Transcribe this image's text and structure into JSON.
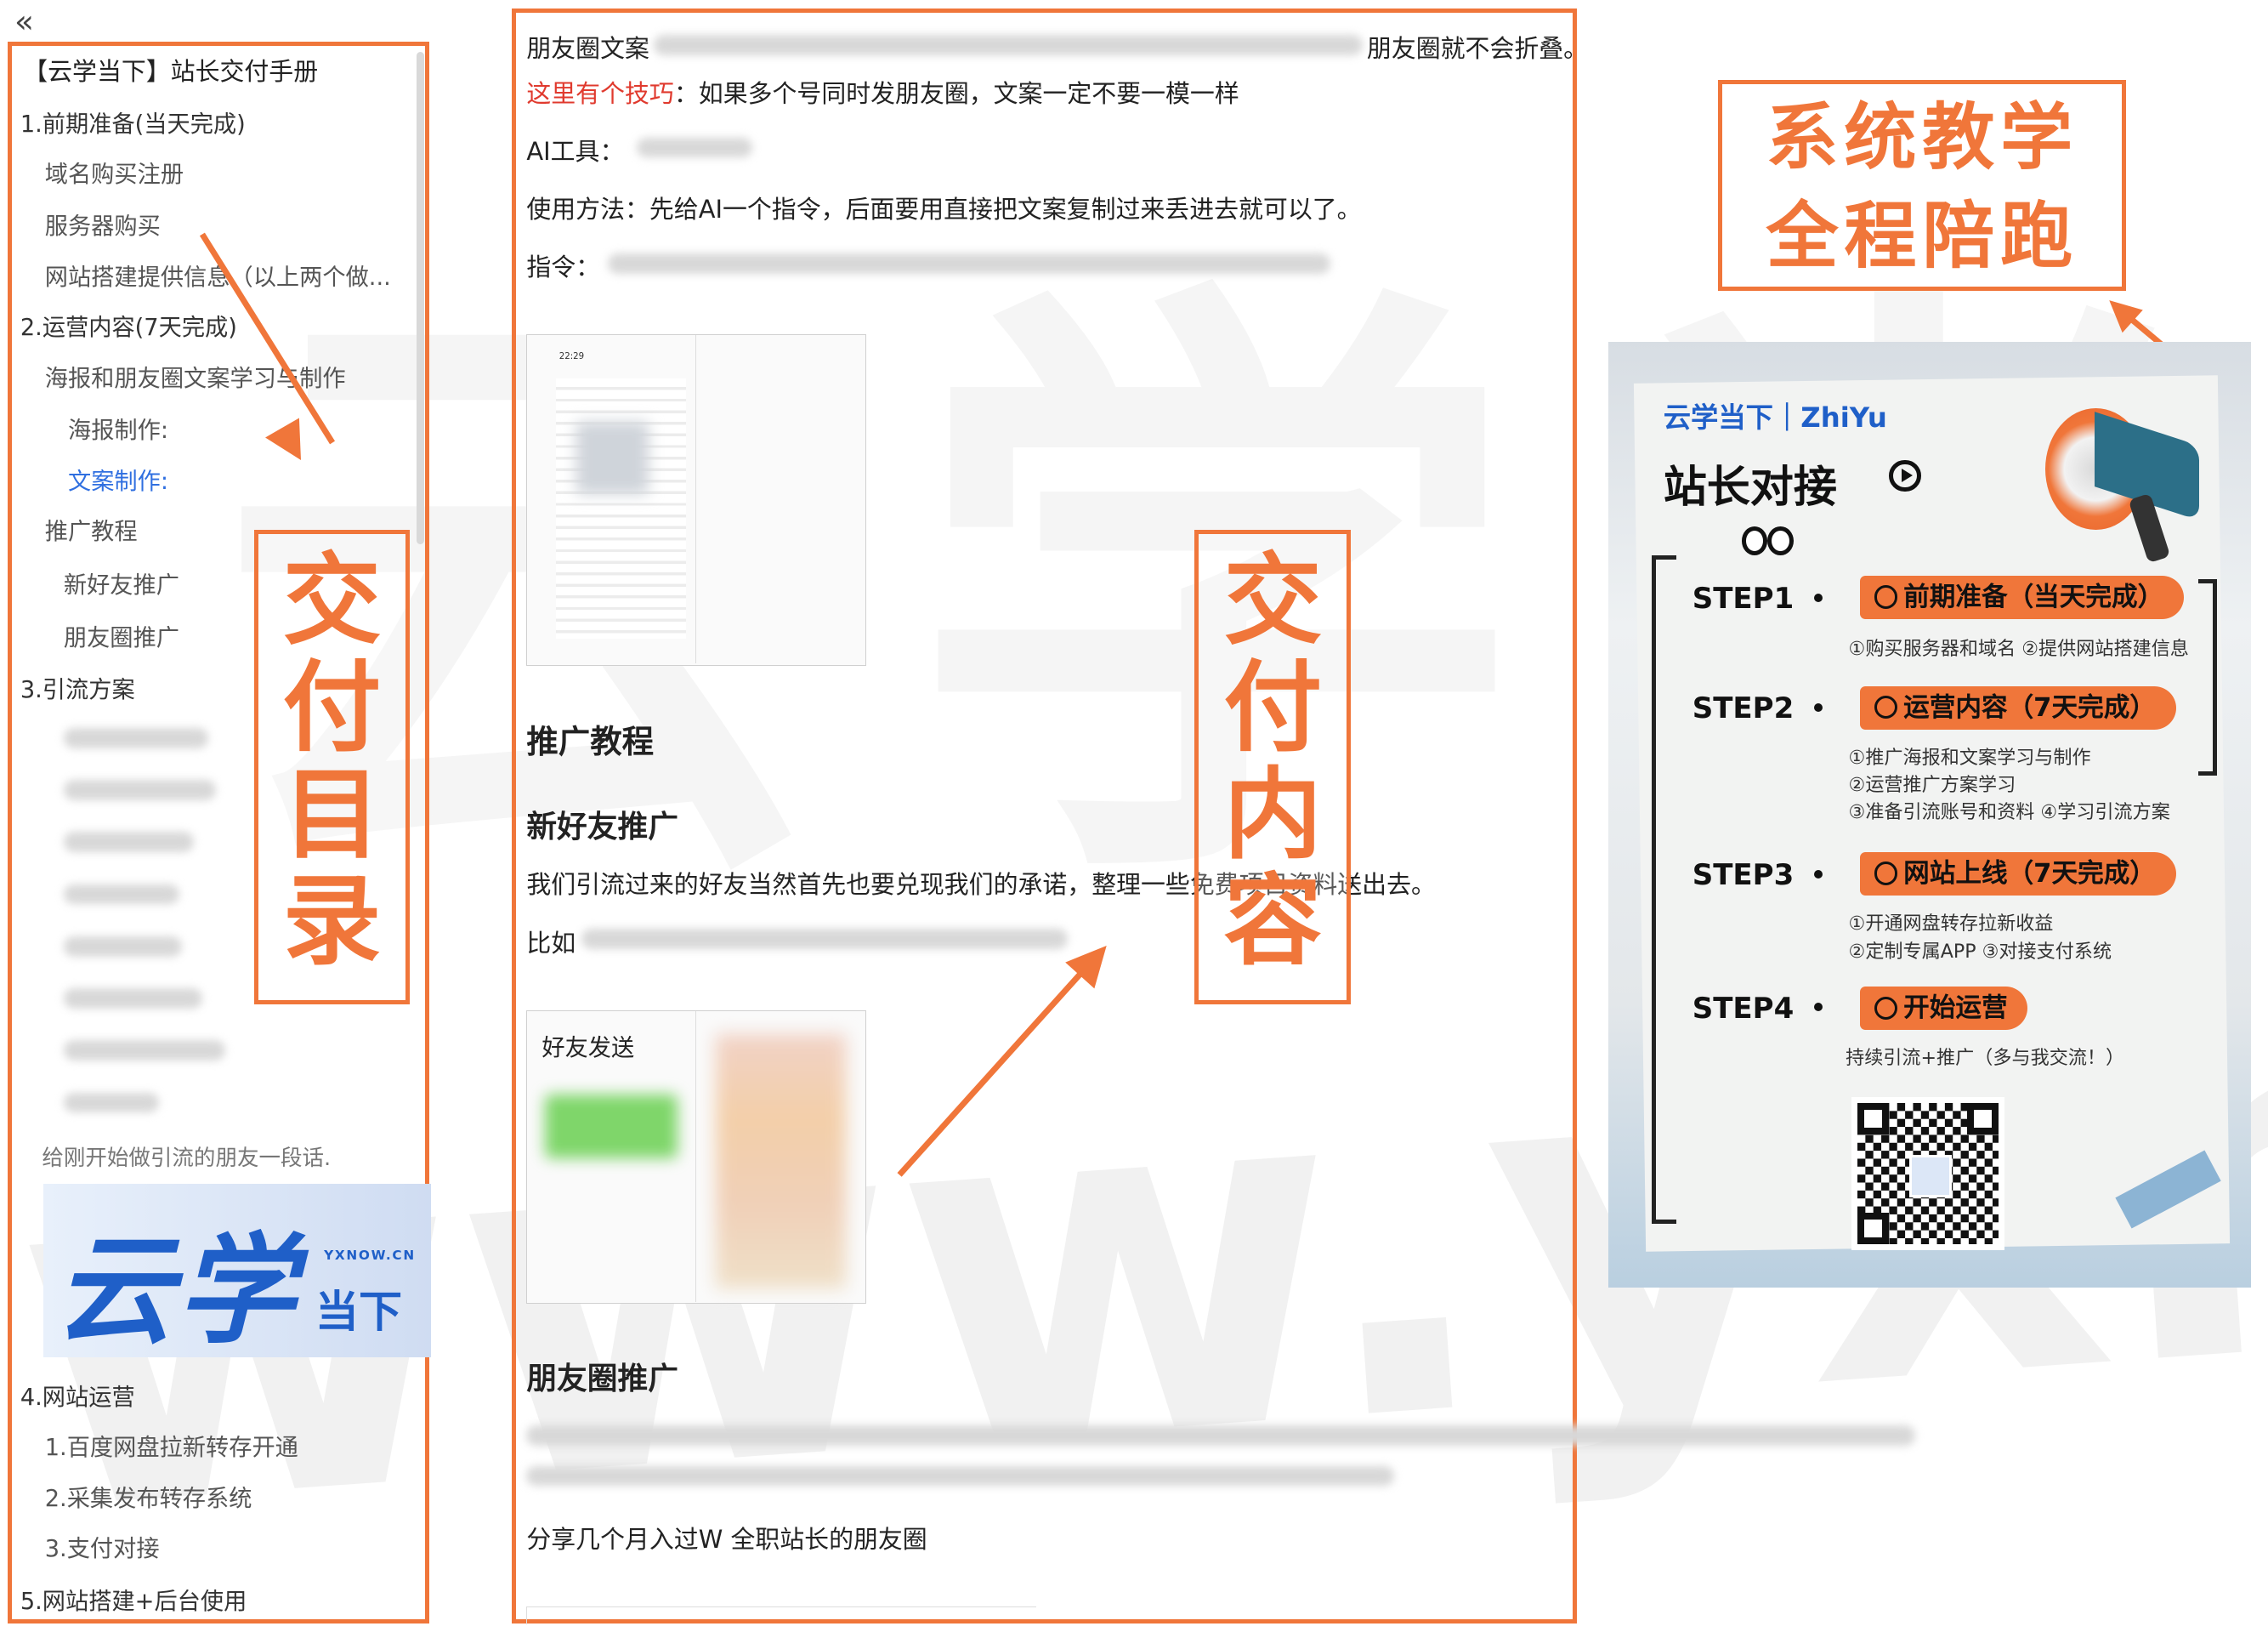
{
  "toc": {
    "collapse_icon": "double-chevron-left-icon",
    "items": [
      {
        "label": "【云学当下】站长交付手册",
        "level": 0
      },
      {
        "label": "1.前期准备(当天完成)",
        "level": 0
      },
      {
        "label": "域名购买注册",
        "level": 1
      },
      {
        "label": "服务器购买",
        "level": 1
      },
      {
        "label": "网站搭建提供信息（以上两个做...",
        "level": 1
      },
      {
        "label": "2.运营内容(7天完成)",
        "level": 0
      },
      {
        "label": "海报和朋友圈文案学习与制作",
        "level": 1
      },
      {
        "label": "海报制作:",
        "level": 2
      },
      {
        "label": "文案制作:",
        "level": 2,
        "active": true
      },
      {
        "label": "推广教程",
        "level": 1
      },
      {
        "label": "新好友推广",
        "level": 2
      },
      {
        "label": "朋友圈推广",
        "level": 2
      },
      {
        "label": "3.引流方案",
        "level": 0
      }
    ],
    "tail_text": "给刚开始做引流的朋友一段话.",
    "logo_text": "云学",
    "logo_small": "当下",
    "logo_domain": "YXNOW.CN",
    "items_bottom": [
      {
        "label": "4.网站运营",
        "level": 0
      },
      {
        "label": "1.百度网盘拉新转存开通",
        "level": 1
      },
      {
        "label": "2.采集发布转存系统",
        "level": 1
      },
      {
        "label": "3.支付对接",
        "level": 1
      },
      {
        "label": "5.网站搭建+后台使用",
        "level": 0
      }
    ]
  },
  "doc": {
    "line1_prefix": "朋友圈文案",
    "line1_suffix": "朋友圈就不会折叠。",
    "tip_label": "这里有个技巧",
    "tip_text": "：如果多个号同时发朋友圈，文案一定不要一模一样",
    "ai_label": "AI工具：",
    "usage": "使用方法：先给AI一个指令，后面要用直接把文案复制过来丢进去就可以了。",
    "instruction_label": "指令：",
    "heading_promo": "推广教程",
    "heading_new_friend": "新好友推广",
    "new_friend_text": "我们引流过来的好友当然首先也要兑现我们的承诺，整理一些免费项目资料送出去。",
    "example_prefix": "比如",
    "friend_send_label": "好友发送",
    "heading_moments": "朋友圈推广",
    "share_text": "分享几个月入过W 全职站长的朋友圈",
    "phone_time": "22:29"
  },
  "callouts": {
    "toc_label": "交付目录",
    "content_label": "交付内容",
    "teaching_line1": "系统教学",
    "teaching_line2": "全程陪跑"
  },
  "poster": {
    "brand": "云学当下｜ZhiYu",
    "title": "站长对接",
    "steps": [
      {
        "label": "STEP1",
        "title": "前期准备（当天完成）",
        "desc": [
          "①购买服务器和域名   ②提供网站搭建信息"
        ]
      },
      {
        "label": "STEP2",
        "title": "运营内容（7天完成）",
        "desc": [
          "①推广海报和文案学习与制作",
          "②运营推广方案学习",
          "③准备引流账号和资料  ④学习引流方案"
        ]
      },
      {
        "label": "STEP3",
        "title": "网站上线（7天完成）",
        "desc": [
          "①开通网盘转存拉新收益",
          "②定制专属APP   ③对接支付系统"
        ]
      },
      {
        "label": "STEP4",
        "title": "开始运营",
        "desc": [
          "持续引流+推广（多与我交流！）"
        ]
      }
    ],
    "icons": [
      "megaphone-icon",
      "eyes-icon",
      "play-circle-icon",
      "qr-code-icon"
    ]
  },
  "watermark": {
    "text": "www.yxnow.cn",
    "top_text": "云学当"
  },
  "colors": {
    "accent": "#f0763a",
    "tip_red": "#e03a2e",
    "toc_active": "#2f6fe0",
    "logo_blue": "#1f5fc8"
  }
}
